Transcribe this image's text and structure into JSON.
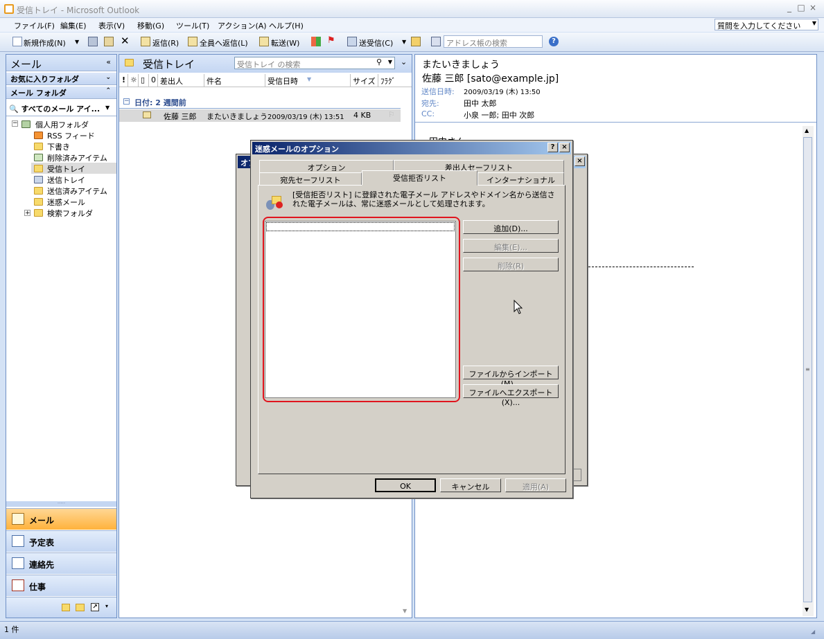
{
  "window": {
    "title": "受信トレイ - Microsoft Outlook",
    "min": "_",
    "max": "□",
    "close": "×"
  },
  "menu": [
    "ファイル(F)",
    "編集(E)",
    "表示(V)",
    "移動(G)",
    "ツール(T)",
    "アクション(A)",
    "ヘルプ(H)"
  ],
  "help_box": {
    "placeholder": "質問を入力してください"
  },
  "toolbar": {
    "new": "新規作成(N)",
    "reply": "返信(R)",
    "reply_all": "全員へ返信(L)",
    "forward": "転送(W)",
    "send_receive": "送受信(C)",
    "address_search": "アドレス帳の検索"
  },
  "nav": {
    "title": "メール",
    "favorites": "お気に入りフォルダ",
    "mail_folders": "メール フォルダ",
    "all_items": "すべてのメール アイ...",
    "tree": [
      "個人用フォルダ",
      "RSS フィード",
      "下書き",
      "削除済みアイテム",
      "受信トレイ",
      "送信トレイ",
      "送信済みアイテム",
      "迷惑メール",
      "検索フォルダ"
    ],
    "buttons": [
      "メール",
      "予定表",
      "連絡先",
      "仕事"
    ]
  },
  "list": {
    "title": "受信トレイ",
    "search_placeholder": "受信トレイ の検索",
    "columns": {
      "from": "差出人",
      "subject": "件名",
      "received": "受信日時",
      "size": "サイズ",
      "flag": "ﾌﾗｸﾞ"
    },
    "group": "日付: 2 週間前",
    "rows": [
      {
        "from": "佐藤 三郎",
        "subject": "またいきましょう",
        "received": "2009/03/19 (木) 13:51",
        "size": "4 KB"
      }
    ]
  },
  "reading": {
    "subject": "またいきましょう",
    "from": "佐藤 三郎 [sato@example.jp]",
    "sent_label": "送信日時:",
    "sent": "2009/03/19 (木) 13:50",
    "to_label": "宛先:",
    "to": "田中 太郎",
    "cc_label": "CC:",
    "cc": "小泉 一郎; 田中 次郎",
    "body_start": "田中さん"
  },
  "back_dialog": {
    "title": "オプ"
  },
  "dialog": {
    "title": "迷惑メールのオプション",
    "help": "?",
    "close": "×",
    "tabs_row1": [
      "オプション",
      "差出人セーフリスト"
    ],
    "tabs_row2": [
      "宛先セーフリスト",
      "受信拒否リスト",
      "インターナショナル"
    ],
    "description_line1": "[受信拒否リスト] に登録された電子メール アドレスやドメイン名から送信さ",
    "description_line2": "れた電子メールは、常に迷惑メールとして処理されます。",
    "add": "追加(D)...",
    "edit": "編集(E)...",
    "remove": "削除(R)",
    "import": "ファイルからインポート(M)...",
    "export": "ファイルへエクスポート(X)...",
    "ok": "OK",
    "cancel": "キャンセル",
    "apply": "適用(A)"
  },
  "status": {
    "text": "1 件"
  }
}
